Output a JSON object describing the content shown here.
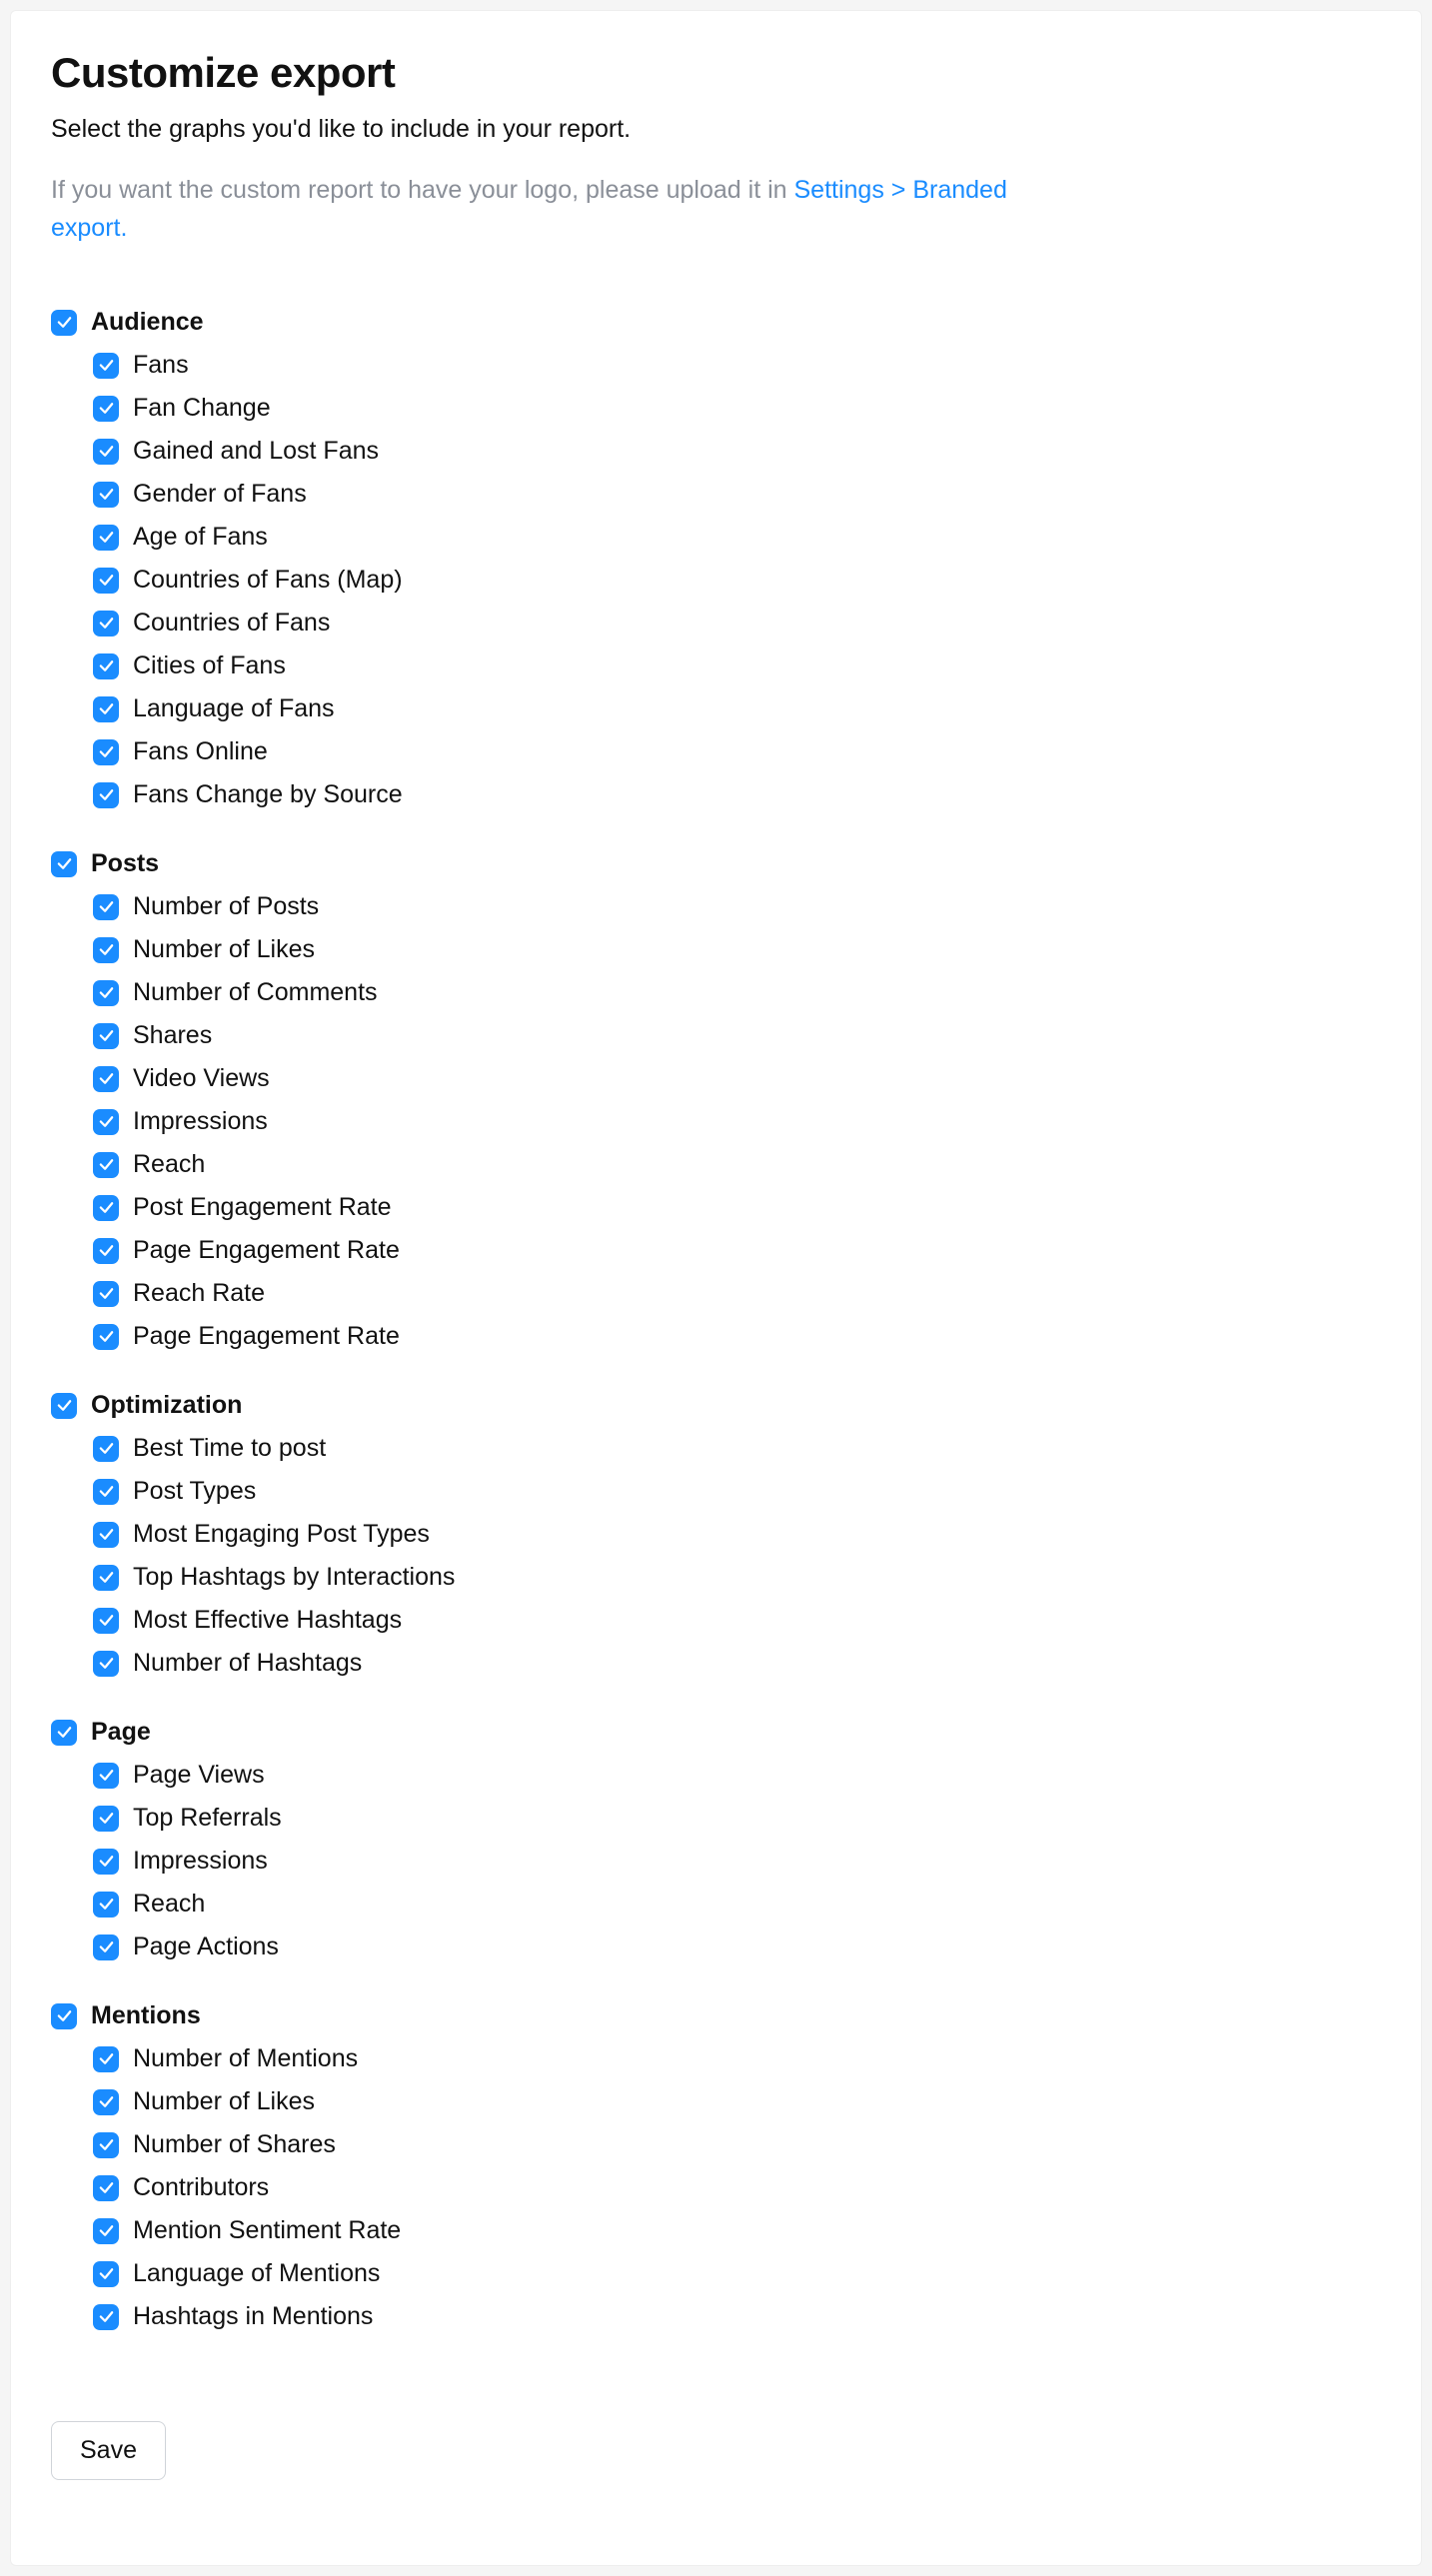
{
  "header": {
    "title": "Customize export",
    "subtitle": "Select the graphs you'd like to include in your report.",
    "note_prefix": "If you want the custom report to have your logo, please upload it in ",
    "note_link": "Settings > Branded export."
  },
  "groups": [
    {
      "title": "Audience",
      "checked": true,
      "items": [
        {
          "label": "Fans",
          "checked": true
        },
        {
          "label": "Fan Change",
          "checked": true
        },
        {
          "label": "Gained and Lost Fans",
          "checked": true
        },
        {
          "label": "Gender of Fans",
          "checked": true
        },
        {
          "label": "Age of Fans",
          "checked": true
        },
        {
          "label": "Countries of Fans (Map)",
          "checked": true
        },
        {
          "label": "Countries of Fans",
          "checked": true
        },
        {
          "label": "Cities of Fans",
          "checked": true
        },
        {
          "label": "Language of Fans",
          "checked": true
        },
        {
          "label": "Fans Online",
          "checked": true
        },
        {
          "label": "Fans Change by Source",
          "checked": true
        }
      ]
    },
    {
      "title": "Posts",
      "checked": true,
      "items": [
        {
          "label": "Number of Posts",
          "checked": true
        },
        {
          "label": "Number of Likes",
          "checked": true
        },
        {
          "label": "Number of Comments",
          "checked": true
        },
        {
          "label": "Shares",
          "checked": true
        },
        {
          "label": "Video Views",
          "checked": true
        },
        {
          "label": "Impressions",
          "checked": true
        },
        {
          "label": "Reach",
          "checked": true
        },
        {
          "label": "Post Engagement Rate",
          "checked": true
        },
        {
          "label": "Page Engagement Rate",
          "checked": true
        },
        {
          "label": "Reach Rate",
          "checked": true
        },
        {
          "label": "Page Engagement Rate",
          "checked": true
        }
      ]
    },
    {
      "title": "Optimization",
      "checked": true,
      "items": [
        {
          "label": "Best Time to post",
          "checked": true
        },
        {
          "label": "Post Types",
          "checked": true
        },
        {
          "label": "Most Engaging Post Types",
          "checked": true
        },
        {
          "label": "Top Hashtags by Interactions",
          "checked": true
        },
        {
          "label": "Most Effective Hashtags",
          "checked": true
        },
        {
          "label": "Number of Hashtags",
          "checked": true
        }
      ]
    },
    {
      "title": "Page",
      "checked": true,
      "items": [
        {
          "label": "Page Views",
          "checked": true
        },
        {
          "label": "Top Referrals",
          "checked": true
        },
        {
          "label": "Impressions",
          "checked": true
        },
        {
          "label": "Reach",
          "checked": true
        },
        {
          "label": "Page Actions",
          "checked": true
        }
      ]
    },
    {
      "title": "Mentions",
      "checked": true,
      "items": [
        {
          "label": "Number of Mentions",
          "checked": true
        },
        {
          "label": "Number of Likes",
          "checked": true
        },
        {
          "label": "Number of Shares",
          "checked": true
        },
        {
          "label": "Contributors",
          "checked": true
        },
        {
          "label": "Mention Sentiment Rate",
          "checked": true
        },
        {
          "label": "Language of Mentions",
          "checked": true
        },
        {
          "label": "Hashtags in Mentions",
          "checked": true
        }
      ]
    }
  ],
  "actions": {
    "save_label": "Save"
  }
}
